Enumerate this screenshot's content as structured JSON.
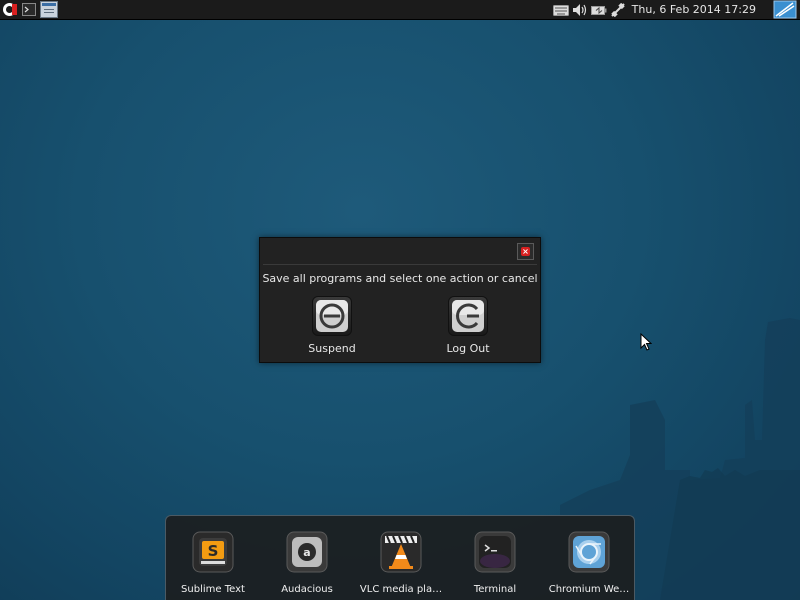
{
  "top_panel": {
    "launcher_icon": "app-launcher-icon",
    "terminal_icon": "terminal-icon",
    "window_icon": "window-list-icon",
    "tray_icons": [
      "keyboard-icon",
      "volume-icon",
      "battery-icon",
      "network-icon"
    ],
    "clock": "Thu,  6 Feb 2014 17:29",
    "corner_icon": "desktop-icon"
  },
  "dialog": {
    "message": "Save all programs and select one action or cancel",
    "close_icon": "close-icon",
    "actions": [
      {
        "label": "Suspend",
        "icon": "suspend-icon"
      },
      {
        "label": "Log Out",
        "icon": "logout-icon"
      }
    ]
  },
  "dock": {
    "items": [
      {
        "label": "Sublime Text",
        "icon": "sublime-text-icon"
      },
      {
        "label": "Audacious",
        "icon": "audacious-icon"
      },
      {
        "label": "VLC media pla…",
        "icon": "vlc-icon"
      },
      {
        "label": "Terminal",
        "icon": "terminal-icon"
      },
      {
        "label": "Chromium We…",
        "icon": "chromium-icon"
      }
    ]
  },
  "colors": {
    "desktop_bg": "#17506e",
    "panel_bg": "#1b1b1b",
    "dialog_bg": "#222222",
    "close_red": "#d82020",
    "sublime_orange": "#f39c12",
    "vlc_orange": "#f28a1a",
    "chromium_blue": "#5fa3d6"
  }
}
